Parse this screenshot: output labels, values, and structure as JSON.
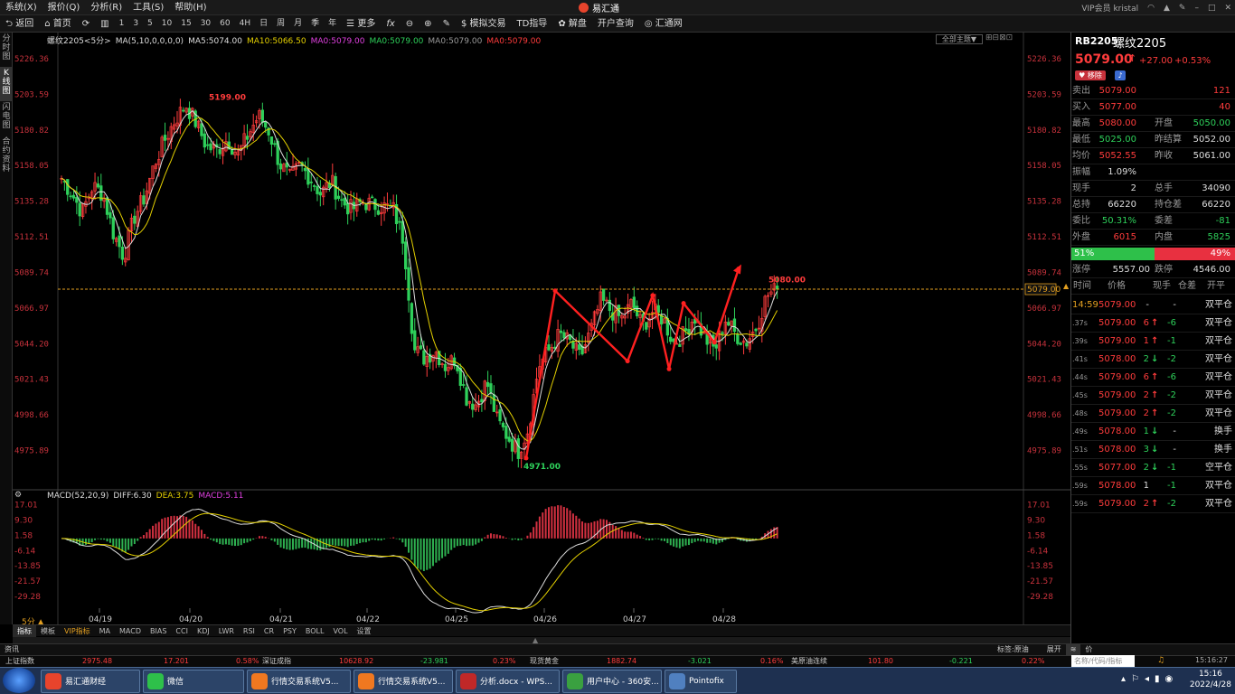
{
  "menu": [
    "系统(X)",
    "报价(Q)",
    "分析(R)",
    "工具(S)",
    "帮助(H)"
  ],
  "app_title": "易汇通",
  "window": {
    "user": "VIP会员 kristal"
  },
  "toolbar": {
    "back": "返回",
    "home": "首页",
    "periods": [
      "1",
      "3",
      "5",
      "10",
      "15",
      "30",
      "60",
      "4H",
      "日",
      "周",
      "月",
      "季",
      "年"
    ],
    "more": "更多",
    "fx": "fx",
    "sim": "模拟交易",
    "td": "TD指导",
    "unlock": "解盘",
    "account": "开户查询",
    "huitong": "汇通网"
  },
  "leftbar": [
    "分时图",
    "K线图",
    "闪电图",
    "合约资料"
  ],
  "chart_header": {
    "symbol": "螺纹2205",
    "period": "<5分>",
    "ma": "MA(5,10,0,0,0,0)",
    "ma5": "MA5:5074.00",
    "ma10": "MA10:5066.50",
    "ma0a": "MA0:5079.00",
    "ma0b": "MA0:5079.00",
    "ma0c": "MA0:5079.00",
    "ma0d": "MA0:5079.00",
    "theme": "全部主题▼"
  },
  "chart_data": {
    "type": "candlestick",
    "ylim": [
      4960,
      5235
    ],
    "y_ticks": [
      "5226.36",
      "5203.59",
      "5180.82",
      "5158.05",
      "5135.28",
      "5112.51",
      "5089.74",
      "5066.97",
      "5044.20",
      "5021.43",
      "4998.66",
      "4975.89"
    ],
    "x_ticks": [
      "04/19",
      "04/20",
      "04/21",
      "04/22",
      "04/25",
      "04/26",
      "04/27",
      "04/28"
    ],
    "high_label": "5199.00",
    "low_label": "4971.00",
    "last_label": "5080.00",
    "current_price": "5079.00",
    "close_path": [
      5150,
      5140,
      5128,
      5145,
      5140,
      5115,
      5100,
      5125,
      5138,
      5160,
      5175,
      5188,
      5197,
      5185,
      5170,
      5168,
      5175,
      5165,
      5178,
      5190,
      5180,
      5160,
      5150,
      5158,
      5150,
      5140,
      5148,
      5135,
      5130,
      5135,
      5133,
      5132,
      5130,
      5110,
      5040,
      5035,
      5040,
      5030,
      5035,
      5010,
      5005,
      5020,
      4995,
      4985,
      4975,
      4990,
      5030,
      5040,
      5050,
      5045,
      5035,
      5052,
      5072,
      5065,
      5060,
      5070,
      5055,
      5065,
      5060,
      5045,
      5050,
      5062,
      5048,
      5040,
      5060,
      5050,
      5045,
      5055,
      5075,
      5079
    ],
    "zigzag": [
      [
        4971,
        0.485
      ],
      [
        5078,
        0.515
      ],
      [
        5033,
        0.59
      ],
      [
        5075,
        0.616
      ],
      [
        5028,
        0.633
      ],
      [
        5070,
        0.648
      ],
      [
        5045,
        0.68
      ],
      [
        5092,
        0.705
      ]
    ],
    "macd": {
      "label": "MACD(52,20,9)",
      "diff": "DIFF:6.30",
      "dea": "DEA:3.75",
      "macd": "MACD:5.11",
      "y_ticks": [
        "17.01",
        "9.30",
        "1.58",
        "-6.14",
        "-13.85",
        "-21.57",
        "-29.28"
      ],
      "ylim": [
        -32,
        20
      ]
    }
  },
  "indicator_tabs": [
    "指标",
    "模板",
    "VIP指标",
    "MA",
    "MACD",
    "BIAS",
    "CCI",
    "KDJ",
    "LWR",
    "RSI",
    "CR",
    "PSY",
    "BOLL",
    "VOL",
    "设置"
  ],
  "period_label": "5分 ▲",
  "infobar": {
    "left": "资讯",
    "tag": "标签:原油",
    "expand": "展开",
    "price": "价"
  },
  "ticker": [
    {
      "name": "上证指数",
      "price": "2975.48",
      "chg": "17.201",
      "pct": "0.58%",
      "dir": "up"
    },
    {
      "name": "深证成指",
      "price": "10628.92",
      "chg": "-23.981",
      "pct": "0.23%",
      "dir": "mix"
    },
    {
      "name": "现货黄金",
      "price": "1882.74",
      "chg": "-3.021",
      "pct": "0.16%",
      "dir": "mix"
    },
    {
      "name": "美原油连续",
      "price": "101.80",
      "chg": "-0.221",
      "pct": "0.22%",
      "dir": "mix"
    }
  ],
  "tick_time": "15:16:27",
  "quote": {
    "code": "RB2205",
    "name": "螺纹2205",
    "price": "5079.00",
    "arrow": "↑",
    "change": "+27.00",
    "pct": "+0.53%",
    "remove": "移除",
    "rows": [
      {
        "l1": "卖出",
        "v1": "5079.00",
        "l2": "",
        "v2": "121",
        "c1": "red",
        "c2": "red"
      },
      {
        "l1": "买入",
        "v1": "5077.00",
        "l2": "",
        "v2": "40",
        "c1": "red",
        "c2": "red"
      },
      {
        "l1": "最高",
        "v1": "5080.00",
        "l2": "开盘",
        "v2": "5050.00",
        "c1": "red",
        "c2": "grn"
      },
      {
        "l1": "最低",
        "v1": "5025.00",
        "l2": "昨结算",
        "v2": "5052.00",
        "c1": "grn",
        "c2": "wht"
      },
      {
        "l1": "均价",
        "v1": "5052.55",
        "l2": "昨收",
        "v2": "5061.00",
        "c1": "red",
        "c2": "wht"
      },
      {
        "l1": "振幅",
        "v1": "1.09%",
        "l2": "",
        "v2": "",
        "c1": "wht",
        "c2": "wht"
      },
      {
        "l1": "现手",
        "v1": "2",
        "l2": "总手",
        "v2": "34090",
        "c1": "wht",
        "c2": "wht"
      },
      {
        "l1": "总持",
        "v1": "66220",
        "l2": "持仓差",
        "v2": "66220",
        "c1": "wht",
        "c2": "wht"
      },
      {
        "l1": "委比",
        "v1": "50.31%",
        "l2": "委差",
        "v2": "-81",
        "c1": "grn",
        "c2": "grn"
      },
      {
        "l1": "外盘",
        "v1": "6015",
        "l2": "内盘",
        "v2": "5825",
        "c1": "red",
        "c2": "grn"
      }
    ],
    "ratio_left": "51%",
    "ratio_right": "49%",
    "limit": {
      "l1": "涨停",
      "v1": "5557.00",
      "l2": "跌停",
      "v2": "4546.00"
    },
    "trade_header": [
      "时间",
      "价格",
      "现手",
      "仓差",
      "开平"
    ],
    "trades": [
      {
        "t": "14:59",
        "p": "5079.00",
        "q": "-",
        "d": "",
        "cd": "-",
        "type": "双平仓",
        "pc": "red",
        "dc": "wht",
        "cc": "wht"
      },
      {
        "t": ".37s",
        "p": "5079.00",
        "q": "6",
        "d": "↑",
        "cd": "-6",
        "type": "双平仓",
        "pc": "red",
        "dc": "red",
        "cc": "grn"
      },
      {
        "t": ".39s",
        "p": "5079.00",
        "q": "1",
        "d": "↑",
        "cd": "-1",
        "type": "双平仓",
        "pc": "red",
        "dc": "red",
        "cc": "grn"
      },
      {
        "t": ".41s",
        "p": "5078.00",
        "q": "2",
        "d": "↓",
        "cd": "-2",
        "type": "双平仓",
        "pc": "red",
        "dc": "grn",
        "cc": "grn"
      },
      {
        "t": ".44s",
        "p": "5079.00",
        "q": "6",
        "d": "↑",
        "cd": "-6",
        "type": "双平仓",
        "pc": "red",
        "dc": "red",
        "cc": "grn"
      },
      {
        "t": ".45s",
        "p": "5079.00",
        "q": "2",
        "d": "↑",
        "cd": "-2",
        "type": "双平仓",
        "pc": "red",
        "dc": "red",
        "cc": "grn"
      },
      {
        "t": ".48s",
        "p": "5079.00",
        "q": "2",
        "d": "↑",
        "cd": "-2",
        "type": "双平仓",
        "pc": "red",
        "dc": "red",
        "cc": "grn"
      },
      {
        "t": ".49s",
        "p": "5078.00",
        "q": "1",
        "d": "↓",
        "cd": "-",
        "type": "换手",
        "pc": "red",
        "dc": "grn",
        "cc": "wht"
      },
      {
        "t": ".51s",
        "p": "5078.00",
        "q": "3",
        "d": "↓",
        "cd": "-",
        "type": "换手",
        "pc": "red",
        "dc": "grn",
        "cc": "wht"
      },
      {
        "t": ".55s",
        "p": "5077.00",
        "q": "2",
        "d": "↓",
        "cd": "-1",
        "type": "空平仓",
        "pc": "red",
        "dc": "grn",
        "cc": "grn"
      },
      {
        "t": ".59s",
        "p": "5078.00",
        "q": "1",
        "d": "",
        "cd": "-1",
        "type": "双平仓",
        "pc": "red",
        "dc": "wht",
        "cc": "grn"
      },
      {
        "t": ".59s",
        "p": "5079.00",
        "q": "2",
        "d": "↑",
        "cd": "-2",
        "type": "双平仓",
        "pc": "red",
        "dc": "red",
        "cc": "grn"
      }
    ],
    "search_placeholder": "名称/代码/指标"
  },
  "taskbar": {
    "items": [
      "易汇通财经",
      "微信",
      "行情交易系统V5...",
      "行情交易系统V5...",
      "分析.docx - WPS...",
      "用户中心 - 360安...",
      "Pointofix"
    ],
    "time": "15:16",
    "date": "2022/4/28"
  },
  "colors": {
    "up": "#ff3c3c",
    "down": "#2ed05a",
    "bg": "#000000",
    "accent": "#e4a020"
  }
}
